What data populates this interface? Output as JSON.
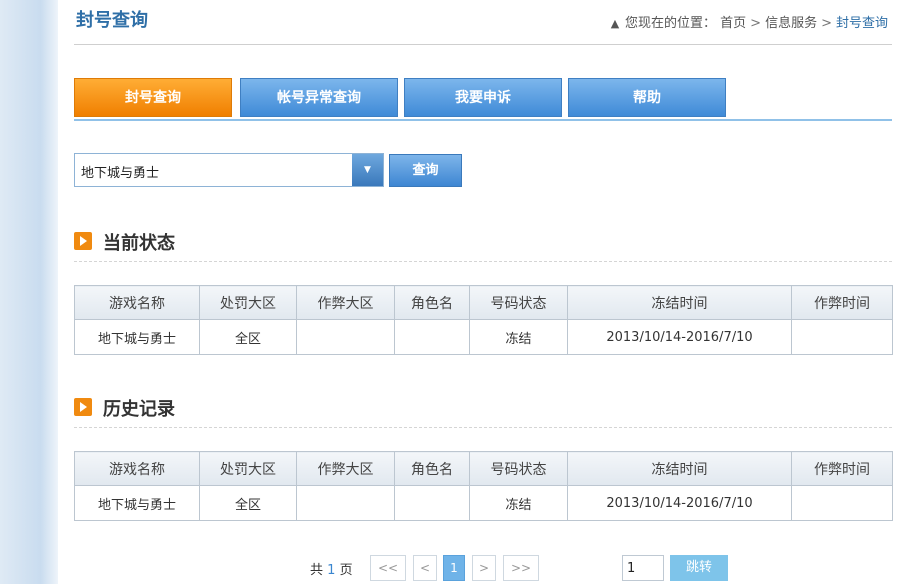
{
  "header": {
    "title": "封号查询",
    "breadcrumb": {
      "prefix": "您现在的位置：",
      "items": [
        "首页",
        "信息服务",
        "封号查询"
      ],
      "separator": ">"
    }
  },
  "tabs": [
    {
      "label": "封号查询",
      "active": true
    },
    {
      "label": "帐号异常查询",
      "active": false
    },
    {
      "label": "我要申诉",
      "active": false
    },
    {
      "label": "帮助",
      "active": false
    }
  ],
  "search": {
    "game_select_value": "地下城与勇士",
    "query_label": "查询"
  },
  "current_status": {
    "title": "当前状态",
    "columns": [
      "游戏名称",
      "处罚大区",
      "作弊大区",
      "角色名",
      "号码状态",
      "冻结时间",
      "作弊时间"
    ],
    "rows": [
      [
        "地下城与勇士",
        "全区",
        "",
        "",
        "冻结",
        "2013/10/14-2016/7/10",
        ""
      ]
    ]
  },
  "history": {
    "title": "历史记录",
    "columns": [
      "游戏名称",
      "处罚大区",
      "作弊大区",
      "角色名",
      "号码状态",
      "冻结时间",
      "作弊时间"
    ],
    "rows": [
      [
        "地下城与勇士",
        "全区",
        "",
        "",
        "冻结",
        "2013/10/14-2016/7/10",
        ""
      ]
    ]
  },
  "pagination": {
    "total_prefix": "共",
    "total_pages": "1",
    "total_suffix": "页",
    "first": "<<",
    "prev": "<",
    "current": "1",
    "next": ">",
    "last": ">>",
    "page_input": "1",
    "go_label": "跳转"
  },
  "colors": {
    "accent_blue": "#2f6fa7",
    "tab_active_orange": "#f07f00",
    "tab_blue": "#3f8ad7"
  },
  "icons": [
    "home-icon",
    "chevron-down-icon",
    "play-icon"
  ]
}
